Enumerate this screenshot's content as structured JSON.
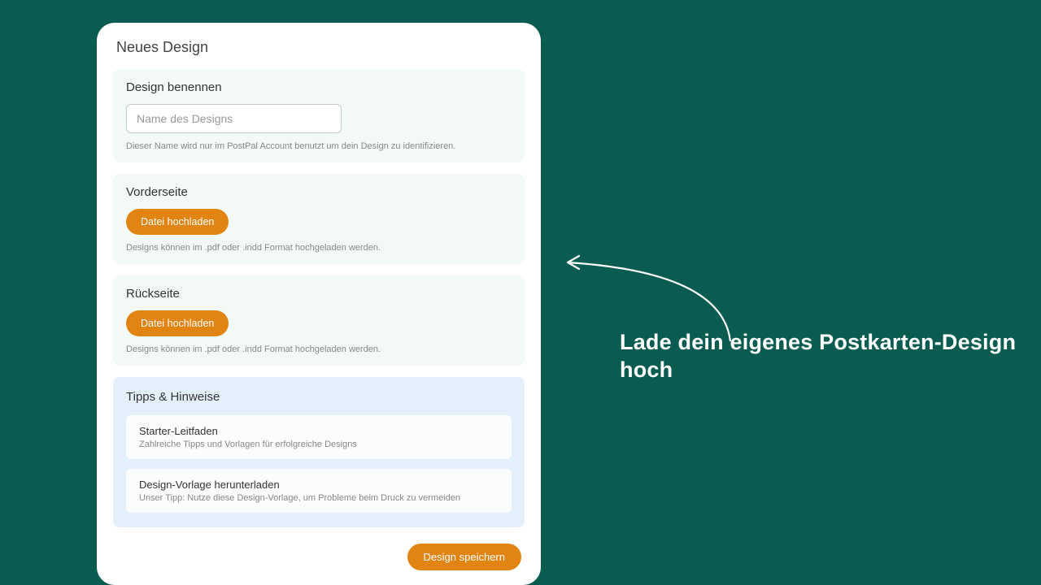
{
  "pageTitle": "Neues Design",
  "name": {
    "title": "Design benennen",
    "placeholder": "Name des Designs",
    "hint": "Dieser Name wird nur im PostPal Account benutzt um dein Design zu identifizieren."
  },
  "front": {
    "title": "Vorderseite",
    "button": "Datei hochladen",
    "hint": "Designs können im .pdf oder .indd Format hochgeladen werden."
  },
  "back": {
    "title": "Rückseite",
    "button": "Datei hochladen",
    "hint": "Designs können im .pdf oder .indd Format hochgeladen werden."
  },
  "tips": {
    "title": "Tipps & Hinweise",
    "items": [
      {
        "title": "Starter-Leitfaden",
        "desc": "Zahlreiche Tipps und Vorlagen für erfolgreiche Designs"
      },
      {
        "title": "Design-Vorlage herunterladen",
        "desc": "Unser Tipp: Nutze diese Design-Vorlage, um Probleme beim Druck zu vermeiden"
      }
    ]
  },
  "saveButton": "Design speichern",
  "annotation": "Lade dein eigenes Postkarten-Design hoch"
}
